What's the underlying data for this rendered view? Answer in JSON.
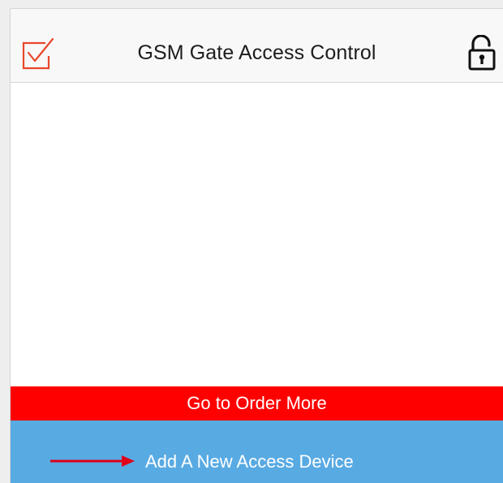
{
  "header": {
    "title": "GSM Gate Access Control",
    "left_icon": "checkbox-check-icon",
    "right_icon": "unlock-icon"
  },
  "buttons": {
    "order_more_label": "Go to Order More",
    "add_device_label": "Add A New Access Device"
  },
  "colors": {
    "accent_red": "#fe0000",
    "accent_blue": "#58aae3",
    "check_icon": "#e8462b"
  }
}
